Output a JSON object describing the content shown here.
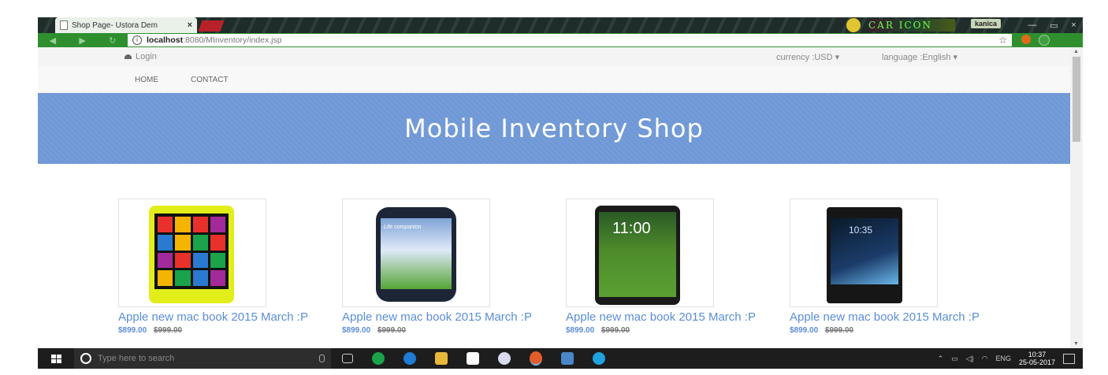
{
  "browser": {
    "tab_title": "Shop Page- Ustora Dem",
    "tab_close": "×",
    "user_chip": "kanica",
    "url_host": "localhost",
    "url_path": ":8080/MInventory/index.jsp",
    "win_minimize": "—",
    "win_restore": "▭",
    "win_close": "×",
    "profile_art": "CAR ICON"
  },
  "header": {
    "login": "Login",
    "currency": "currency :USD ▾",
    "language": "language :English ▾"
  },
  "nav": {
    "home": "HOME",
    "contact": "CONTACT"
  },
  "banner": {
    "title": "Mobile Inventory Shop"
  },
  "products": [
    {
      "name": "Apple new mac book 2015 March :P",
      "price": "$899.00",
      "old_price": "$999.00",
      "image": "nokia-lumia-yellow-phone"
    },
    {
      "name": "Apple new mac book 2015 March :P",
      "price": "$899.00",
      "old_price": "$999.00",
      "image": "samsung-galaxy-phone",
      "screen_text": "Life companion"
    },
    {
      "name": "Apple new mac book 2015 March :P",
      "price": "$899.00",
      "old_price": "$999.00",
      "image": "lg-g2-phone",
      "screen_text": "11:00"
    },
    {
      "name": "Apple new mac book 2015 March :P",
      "price": "$899.00",
      "old_price": "$999.00",
      "image": "sony-xperia-phone",
      "screen_text": "10:35"
    }
  ],
  "taskbar": {
    "search_placeholder": "Type here to search",
    "language": "ENG",
    "time": "10:37",
    "date": "25-05-2017"
  },
  "colors": {
    "banner": "#6f98d6",
    "link": "#5b8ed6",
    "toolbar": "#2f8f2f"
  }
}
